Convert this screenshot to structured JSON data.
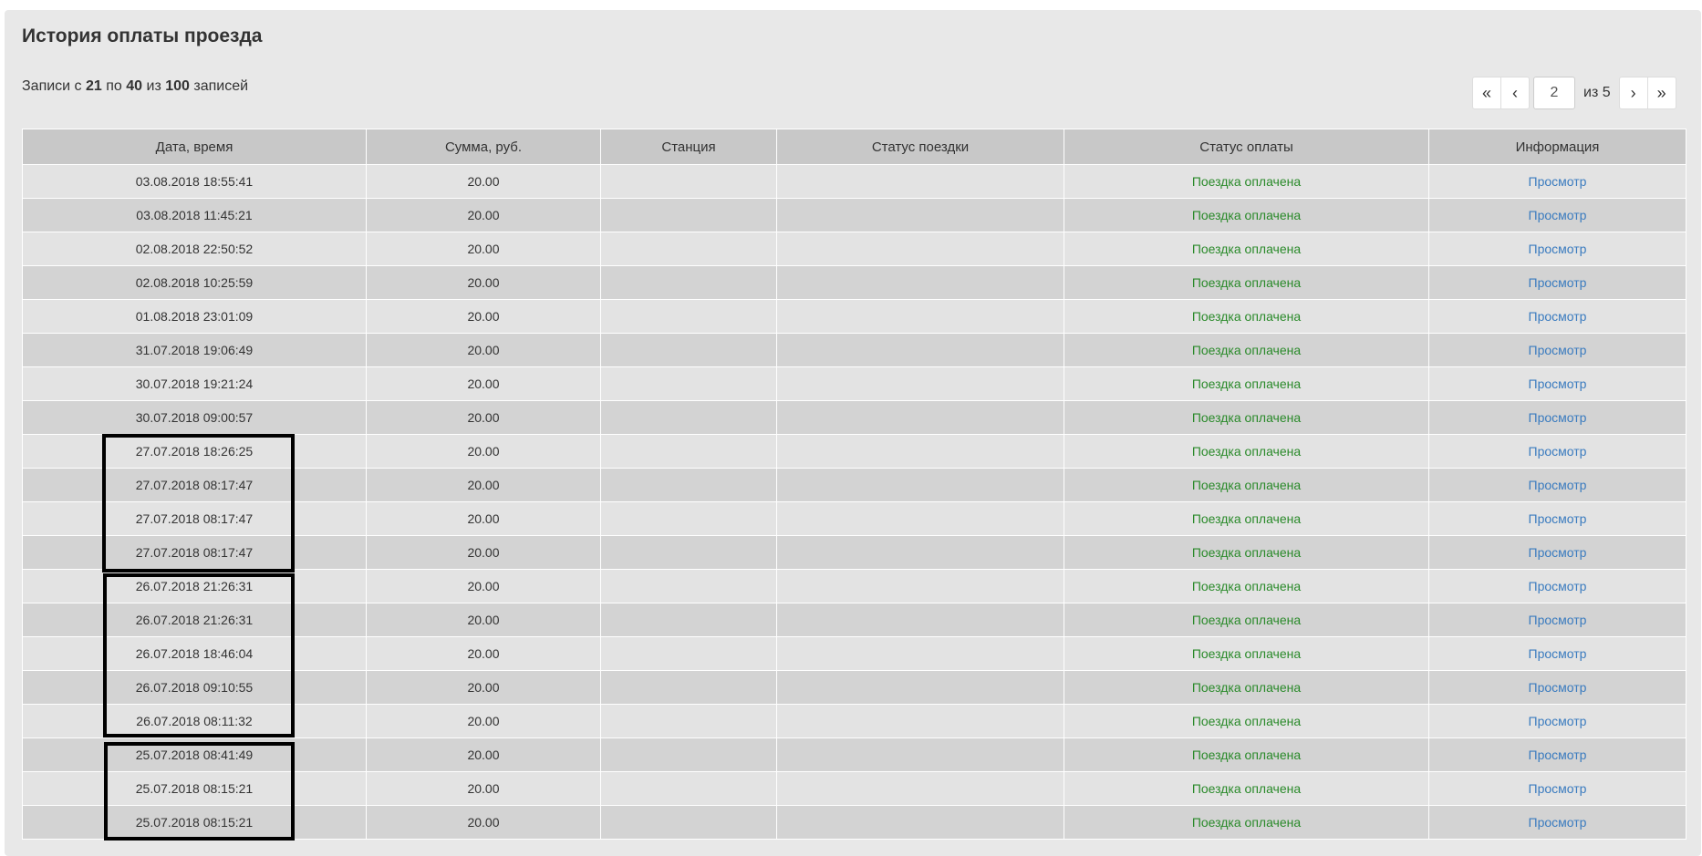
{
  "title": "История оплаты проезда",
  "records": {
    "prefix": "Записи с",
    "from": "21",
    "mid1": "по",
    "to": "40",
    "mid2": "из",
    "total": "100",
    "suffix": "записей"
  },
  "pagination": {
    "first": "«",
    "prev": "‹",
    "current_page": "2",
    "of_label": "из 5",
    "next": "›",
    "last": "»"
  },
  "table": {
    "headers": [
      "Дата, время",
      "Сумма, руб.",
      "Станция",
      "Статус поездки",
      "Статус оплаты",
      "Информация"
    ],
    "rows": [
      {
        "datetime": "03.08.2018 18:55:41",
        "amount": "20.00",
        "station": "",
        "trip_status": "",
        "pay_status": "Поездка оплачена",
        "info": "Просмотр"
      },
      {
        "datetime": "03.08.2018 11:45:21",
        "amount": "20.00",
        "station": "",
        "trip_status": "",
        "pay_status": "Поездка оплачена",
        "info": "Просмотр"
      },
      {
        "datetime": "02.08.2018 22:50:52",
        "amount": "20.00",
        "station": "",
        "trip_status": "",
        "pay_status": "Поездка оплачена",
        "info": "Просмотр"
      },
      {
        "datetime": "02.08.2018 10:25:59",
        "amount": "20.00",
        "station": "",
        "trip_status": "",
        "pay_status": "Поездка оплачена",
        "info": "Просмотр"
      },
      {
        "datetime": "01.08.2018 23:01:09",
        "amount": "20.00",
        "station": "",
        "trip_status": "",
        "pay_status": "Поездка оплачена",
        "info": "Просмотр"
      },
      {
        "datetime": "31.07.2018 19:06:49",
        "amount": "20.00",
        "station": "",
        "trip_status": "",
        "pay_status": "Поездка оплачена",
        "info": "Просмотр"
      },
      {
        "datetime": "30.07.2018 19:21:24",
        "amount": "20.00",
        "station": "",
        "trip_status": "",
        "pay_status": "Поездка оплачена",
        "info": "Просмотр"
      },
      {
        "datetime": "30.07.2018 09:00:57",
        "amount": "20.00",
        "station": "",
        "trip_status": "",
        "pay_status": "Поездка оплачена",
        "info": "Просмотр"
      },
      {
        "datetime": "27.07.2018 18:26:25",
        "amount": "20.00",
        "station": "",
        "trip_status": "",
        "pay_status": "Поездка оплачена",
        "info": "Просмотр"
      },
      {
        "datetime": "27.07.2018 08:17:47",
        "amount": "20.00",
        "station": "",
        "trip_status": "",
        "pay_status": "Поездка оплачена",
        "info": "Просмотр"
      },
      {
        "datetime": "27.07.2018 08:17:47",
        "amount": "20.00",
        "station": "",
        "trip_status": "",
        "pay_status": "Поездка оплачена",
        "info": "Просмотр"
      },
      {
        "datetime": "27.07.2018 08:17:47",
        "amount": "20.00",
        "station": "",
        "trip_status": "",
        "pay_status": "Поездка оплачена",
        "info": "Просмотр"
      },
      {
        "datetime": "26.07.2018 21:26:31",
        "amount": "20.00",
        "station": "",
        "trip_status": "",
        "pay_status": "Поездка оплачена",
        "info": "Просмотр"
      },
      {
        "datetime": "26.07.2018 21:26:31",
        "amount": "20.00",
        "station": "",
        "trip_status": "",
        "pay_status": "Поездка оплачена",
        "info": "Просмотр"
      },
      {
        "datetime": "26.07.2018 18:46:04",
        "amount": "20.00",
        "station": "",
        "trip_status": "",
        "pay_status": "Поездка оплачена",
        "info": "Просмотр"
      },
      {
        "datetime": "26.07.2018 09:10:55",
        "amount": "20.00",
        "station": "",
        "trip_status": "",
        "pay_status": "Поездка оплачена",
        "info": "Просмотр"
      },
      {
        "datetime": "26.07.2018 08:11:32",
        "amount": "20.00",
        "station": "",
        "trip_status": "",
        "pay_status": "Поездка оплачена",
        "info": "Просмотр"
      },
      {
        "datetime": "25.07.2018 08:41:49",
        "amount": "20.00",
        "station": "",
        "trip_status": "",
        "pay_status": "Поездка оплачена",
        "info": "Просмотр"
      },
      {
        "datetime": "25.07.2018 08:15:21",
        "amount": "20.00",
        "station": "",
        "trip_status": "",
        "pay_status": "Поездка оплачена",
        "info": "Просмотр"
      },
      {
        "datetime": "25.07.2018 08:15:21",
        "amount": "20.00",
        "station": "",
        "trip_status": "",
        "pay_status": "Поездка оплачена",
        "info": "Просмотр"
      }
    ]
  },
  "colors": {
    "panel_bg": "#e8e8e8",
    "header_bg": "#c8c8c8",
    "row_odd": "#e3e3e3",
    "row_even": "#d3d3d3",
    "pay_status": "#2a8a2a",
    "link": "#3a7bbf",
    "highlight": "#000000"
  }
}
